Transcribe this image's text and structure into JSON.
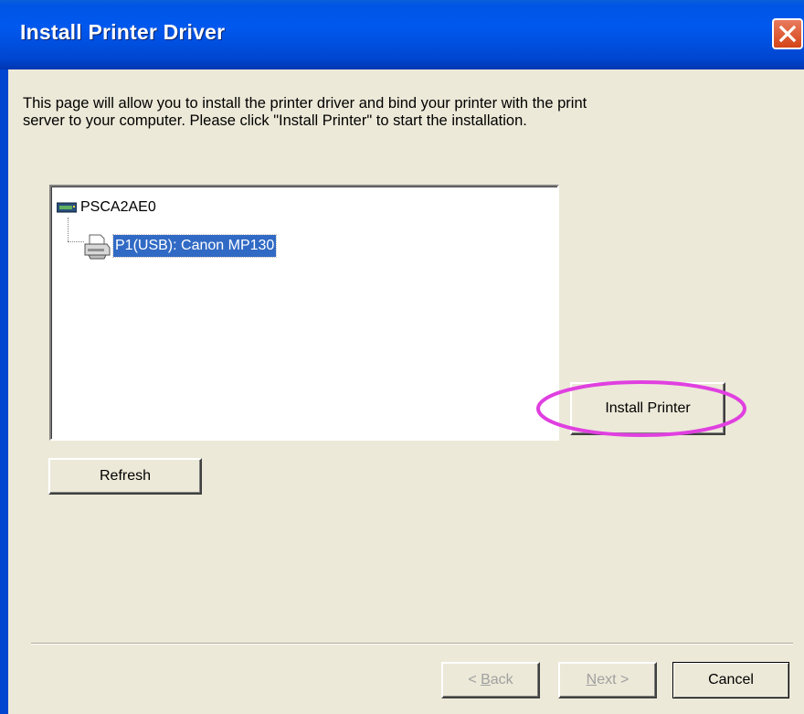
{
  "window": {
    "title": "Install Printer Driver",
    "close_icon": "close-icon"
  },
  "instructions": {
    "line1": "This page will allow you to install the printer driver and bind your printer with the print",
    "line2": "server to your computer. Please click \"Install Printer\" to start the installation."
  },
  "tree": {
    "root": {
      "label": "PSCA2AE0",
      "icon": "print-server-icon"
    },
    "children": [
      {
        "label": "P1(USB): Canon MP130",
        "icon": "printer-icon",
        "selected": true
      }
    ]
  },
  "buttons": {
    "install_printer": "Install Printer",
    "refresh": "Refresh",
    "back_mnemonic": "B",
    "back_rest": "ack",
    "back_prefix": "< ",
    "next_mnemonic": "N",
    "next_rest": "ext >",
    "cancel": "Cancel"
  },
  "colors": {
    "titlebar": "#0058ee",
    "selection": "#316ac5",
    "highlight_ellipse": "#e040e0",
    "dialog_bg": "#ece9d8"
  }
}
